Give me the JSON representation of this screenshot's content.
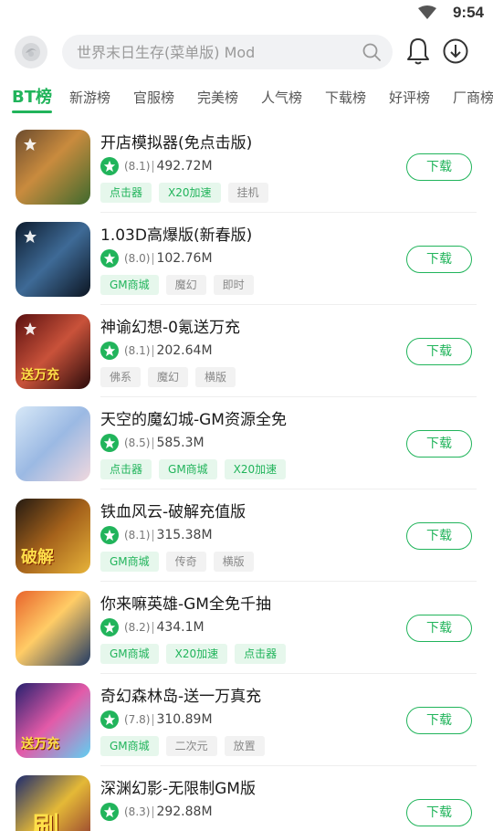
{
  "status_bar": {
    "time": "9:54"
  },
  "search": {
    "placeholder": "世界末日生存(菜单版) Mod"
  },
  "tabs": [
    "BT榜",
    "新游榜",
    "官服榜",
    "完美榜",
    "人气榜",
    "下载榜",
    "好评榜",
    "厂商榜"
  ],
  "active_tab": "BT榜",
  "games": [
    {
      "title": "开店模拟器(免点击版)",
      "score": "(8.1)",
      "size": "492.72M",
      "tags": [
        "点击器",
        "X20加速",
        "挂机"
      ],
      "button": "下载"
    },
    {
      "title": "1.03D高爆版(新春版)",
      "score": "(8.0)",
      "size": "102.76M",
      "tags": [
        "GM商城",
        "魔幻",
        "即时"
      ],
      "button": "下载"
    },
    {
      "title": "神谕幻想-0氪送万充",
      "score": "(8.1)",
      "size": "202.64M",
      "tags": [
        "佛系",
        "魔幻",
        "横版"
      ],
      "button": "下载"
    },
    {
      "title": "天空的魔幻城-GM资源全免",
      "score": "(8.5)",
      "size": "585.3M",
      "tags": [
        "点击器",
        "GM商城",
        "X20加速"
      ],
      "button": "下载"
    },
    {
      "title": "铁血风云-破解充值版",
      "score": "(8.1)",
      "size": "315.38M",
      "tags": [
        "GM商城",
        "传奇",
        "横版"
      ],
      "button": "下载"
    },
    {
      "title": "你来嘛英雄-GM全免千抽",
      "score": "(8.2)",
      "size": "434.1M",
      "tags": [
        "GM商城",
        "X20加速",
        "点击器"
      ],
      "button": "下载"
    },
    {
      "title": "奇幻森林岛-送一万真充",
      "score": "(7.8)",
      "size": "310.89M",
      "tags": [
        "GM商城",
        "二次元",
        "放置"
      ],
      "button": "下载"
    },
    {
      "title": "深渊幻影-无限制GM版",
      "score": "(8.3)",
      "size": "292.88M",
      "tags": [],
      "button": "下载"
    }
  ],
  "tag_colors": {
    "green": "#21b45b",
    "green_bg": "#e6f7ec",
    "gray": "#888888",
    "gray_bg": "#f2f2f2"
  },
  "thumb_badges": [
    "送万充",
    "破解",
    "送万充",
    "刷"
  ],
  "icons": [
    "app-logo-icon",
    "search-icon",
    "bell-icon",
    "download-manager-icon",
    "star-icon",
    "wifi-icon"
  ]
}
